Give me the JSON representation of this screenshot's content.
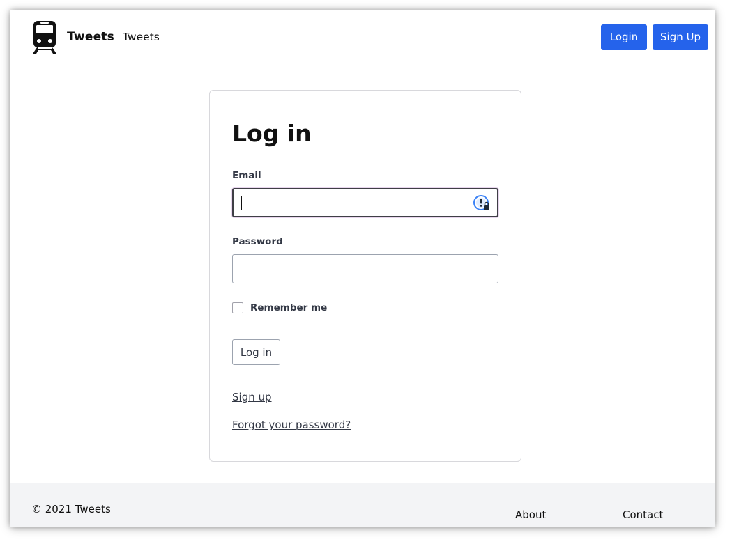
{
  "navbar": {
    "logo_icon": "train-icon",
    "brand_name": "Tweets",
    "nav_link": "Tweets",
    "login_label": "Login",
    "signup_label": "Sign Up",
    "accent_color": "#2563eb"
  },
  "form": {
    "title": "Log in",
    "email_label": "Email",
    "email_value": "",
    "password_label": "Password",
    "password_value": "",
    "password_manager_icon": "password-manager-icon",
    "remember_label": "Remember me",
    "remember_checked": false,
    "submit_label": "Log in",
    "signup_link": "Sign up",
    "forgot_link": "Forgot your password?"
  },
  "footer": {
    "copyright": "© 2021 Tweets",
    "about_link": "About",
    "contact_link": "Contact"
  }
}
